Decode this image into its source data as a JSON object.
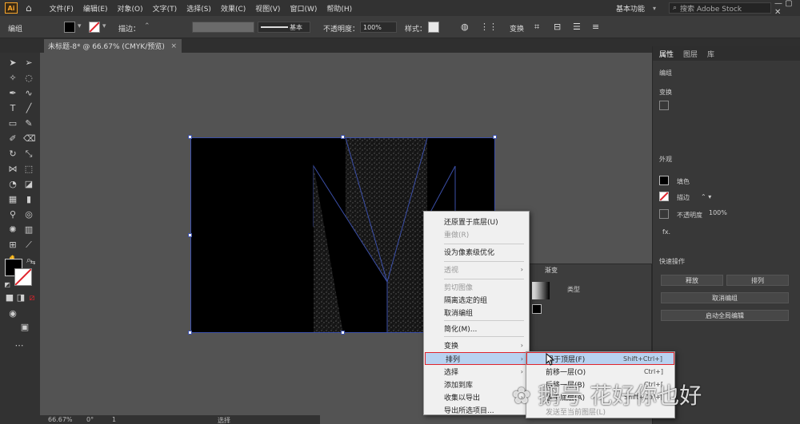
{
  "app": {
    "logo": "Ai",
    "workspace": "基本功能",
    "search_placeholder": "搜索 Adobe Stock"
  },
  "menubar": [
    "文件(F)",
    "编辑(E)",
    "对象(O)",
    "文字(T)",
    "选择(S)",
    "效果(C)",
    "视图(V)",
    "窗口(W)",
    "帮助(H)"
  ],
  "control": {
    "mode_label": "编组",
    "stroke_label": "描边：",
    "stroke_style": "基本",
    "opacity_label": "不透明度：",
    "opacity_value": "100%",
    "style_label": "样式：",
    "transform_label": "变换"
  },
  "document_tab": {
    "title": "未标题-8* @ 66.67% (CMYK/预览)",
    "close": "×"
  },
  "right_panel": {
    "tabs": [
      "属性",
      "图层",
      "库"
    ],
    "section_group": "编组",
    "section_transform": "变换",
    "section_appearance": "外观",
    "fill_label": "填色",
    "stroke_label": "描边",
    "opacity_label": "不透明度",
    "opacity_value": "100%",
    "fx_label": "fx.",
    "quick_actions": "快速操作",
    "ungroup": "取消编组",
    "arrange": "排列",
    "release": "释放",
    "start_global_edit": "启动全局编辑"
  },
  "float_panel": {
    "title": "渐变",
    "type_label": "类型"
  },
  "context_menu": {
    "items": [
      {
        "label": "还原置于底层(U)",
        "disabled": false,
        "submenu": false
      },
      {
        "label": "重做(R)",
        "disabled": true,
        "submenu": false
      },
      {
        "label": "设为像素级优化",
        "disabled": false,
        "submenu": false
      },
      {
        "label": "透视",
        "disabled": true,
        "submenu": true
      },
      {
        "label": "剪切图像",
        "disabled": true,
        "submenu": false
      },
      {
        "label": "隔离选定的组",
        "disabled": false,
        "submenu": false
      },
      {
        "label": "取消编组",
        "disabled": false,
        "submenu": false
      },
      {
        "label": "简化(M)...",
        "disabled": false,
        "submenu": false
      },
      {
        "label": "变换",
        "disabled": false,
        "submenu": true
      },
      {
        "label": "排列",
        "disabled": false,
        "submenu": true,
        "highlighted": true
      },
      {
        "label": "选择",
        "disabled": false,
        "submenu": true
      },
      {
        "label": "添加到库",
        "disabled": false,
        "submenu": false
      },
      {
        "label": "收集以导出",
        "disabled": false,
        "submenu": true
      },
      {
        "label": "导出所选项目...",
        "disabled": false,
        "submenu": false
      }
    ]
  },
  "arrange_submenu": {
    "items": [
      {
        "label": "置于顶层(F)",
        "shortcut": "Shift+Ctrl+]",
        "highlighted": true
      },
      {
        "label": "前移一层(O)",
        "shortcut": "Ctrl+]"
      },
      {
        "label": "后移一层(B)",
        "shortcut": "Ctrl+["
      },
      {
        "label": "置于底层(A)",
        "shortcut": "Shift+Ctrl+["
      },
      {
        "label": "发送至当前图层(L)",
        "shortcut": "",
        "disabled": true
      }
    ]
  },
  "status": {
    "zoom": "66.67%",
    "angle": "0°",
    "page": "1",
    "tool": "选择"
  },
  "watermark": "✿ 鹅号 花好你也好",
  "colors": {
    "accent_highlight": "#b8d2f0",
    "highlight_border": "#e0242c",
    "selection": "#3b4fa8",
    "ai_orange": "#f7a52b"
  }
}
